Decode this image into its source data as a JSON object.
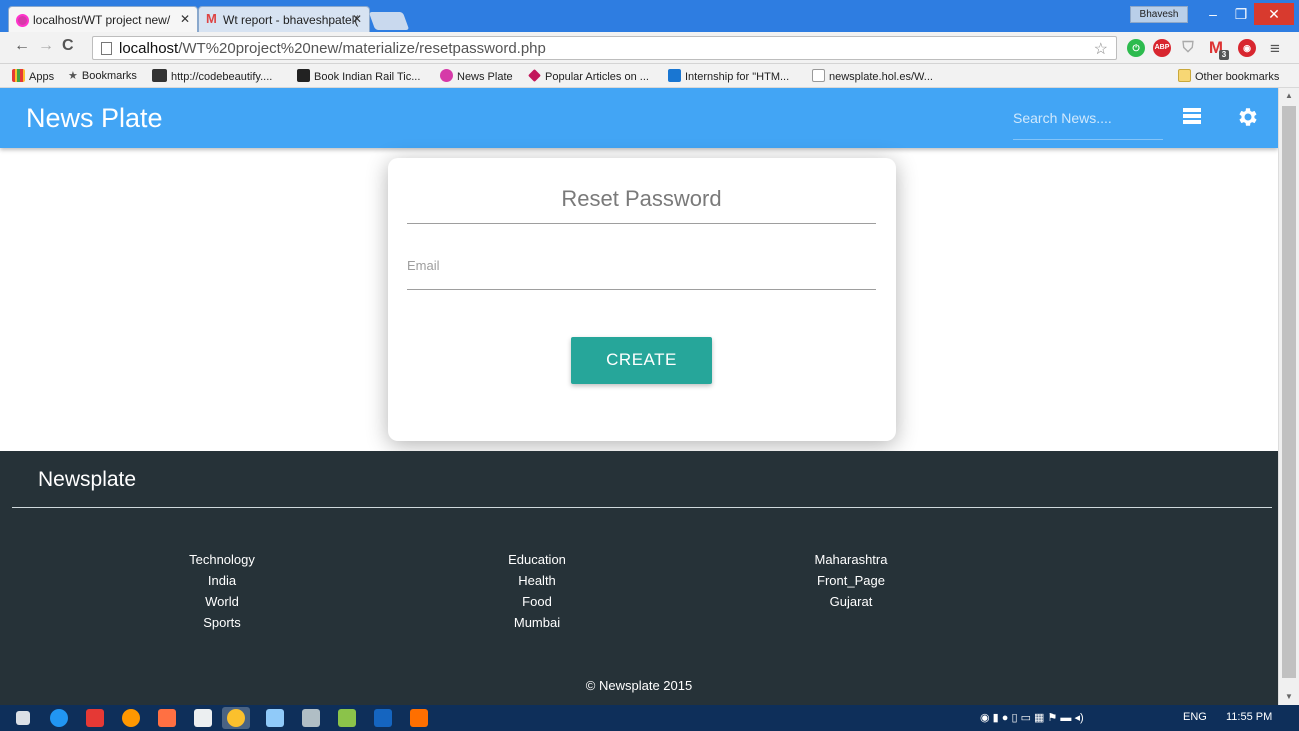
{
  "browser": {
    "tabs": [
      {
        "label": "localhost/WT project new/"
      },
      {
        "label": "Wt report - bhaveshpatel("
      }
    ],
    "profile_name": "Bhavesh",
    "url_host": "localhost",
    "url_path": "/WT%20project%20new/materialize/resetpassword.php",
    "bookmarks": [
      {
        "label": "Apps"
      },
      {
        "label": "Bookmarks"
      },
      {
        "label": "http://codebeautify...."
      },
      {
        "label": "Book Indian Rail Tic..."
      },
      {
        "label": "News Plate"
      },
      {
        "label": "Popular Articles on ..."
      },
      {
        "label": "Internship for \"HTM..."
      },
      {
        "label": "newsplate.hol.es/W..."
      }
    ],
    "other_bookmarks": "Other bookmarks",
    "ext_badge": "3",
    "abp_label": "ABP"
  },
  "header": {
    "brand": "News Plate",
    "search_placeholder": "Search News...."
  },
  "reset_card": {
    "title": "Reset Password",
    "email_placeholder": "Email",
    "create_label": "CREATE"
  },
  "footer": {
    "title": "Newsplate",
    "columns": [
      [
        "Technology",
        "India",
        "World",
        "Sports"
      ],
      [
        "Education",
        "Health",
        "Food",
        "Mumbai"
      ],
      [
        "Maharashtra",
        "Front_Page",
        "Gujarat"
      ]
    ],
    "copyright": "© Newsplate 2015"
  },
  "taskbar": {
    "language": "ENG",
    "time": "11:55 PM"
  },
  "colors": {
    "appbar": "#42a5f5",
    "button": "#26a69a",
    "footer": "#263238"
  }
}
